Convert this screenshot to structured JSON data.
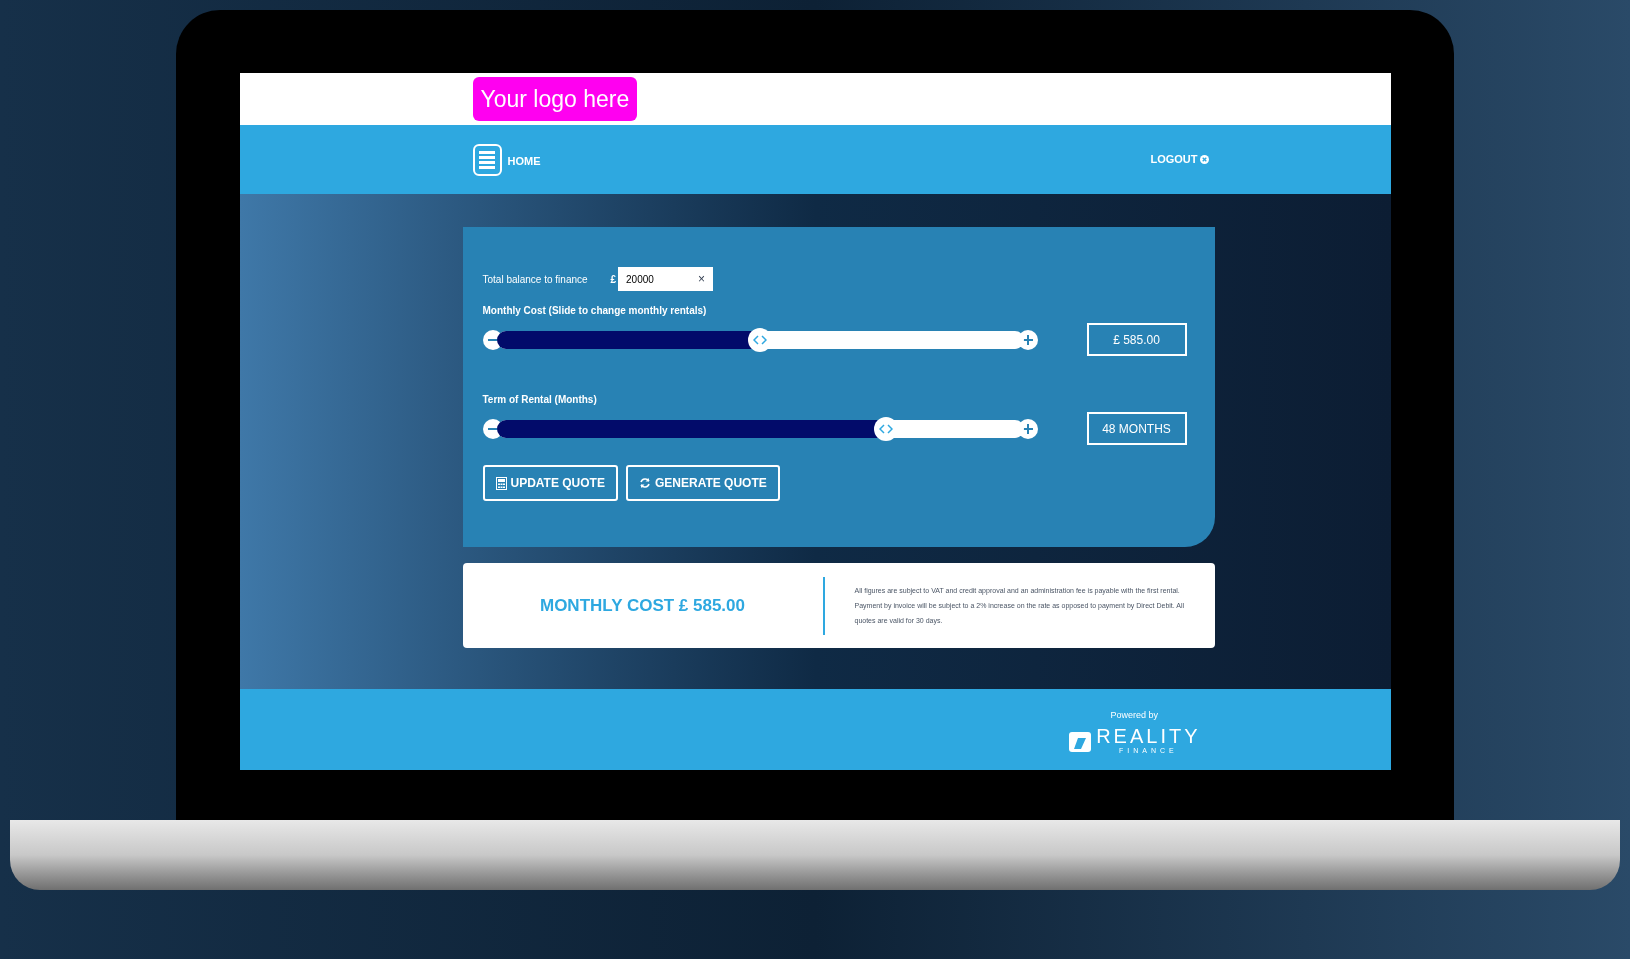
{
  "header": {
    "logo": "Your logo here"
  },
  "nav": {
    "home": "HOME",
    "logout": "LOGOUT"
  },
  "balance": {
    "label": "Total balance to finance",
    "currency": "£",
    "value": "20000",
    "clear": "×"
  },
  "sliders": [
    {
      "label": "Monthly Cost (Slide to change monthly rentals)",
      "level": 0.5,
      "reading": "£ 585.00"
    },
    {
      "label": "Term of Rental (Months)",
      "level": 0.74,
      "reading": "48 MONTHS"
    }
  ],
  "buttons": [
    {
      "kind": "calculator",
      "label": "UPDATE QUOTE"
    },
    {
      "kind": "refresh",
      "label": "GENERATE QUOTE"
    }
  ],
  "result": {
    "headline": "MONTHLY COST £ 585.00",
    "disclaimer": "All figures are subject to VAT and credit approval and an administration fee is payable with the first rental. Payment by invoice will be subject to a 2% increase on the rate as opposed to payment by Direct Debit. All quotes are valid for 30 days."
  },
  "footer": {
    "powered_by": "Powered by",
    "brand": "REALITY",
    "brand_sub": "FINANCE"
  }
}
